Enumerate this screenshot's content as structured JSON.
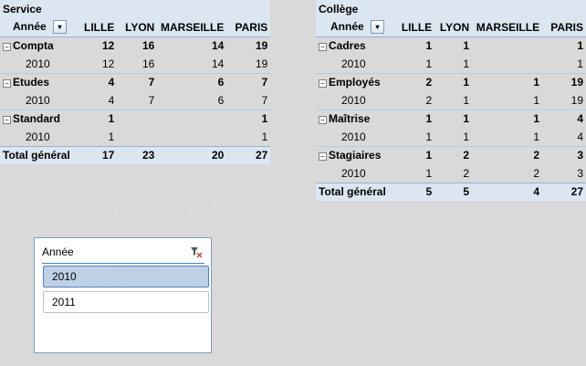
{
  "watermark": "©excel-formations.fr",
  "pivot_left": {
    "title": "Service",
    "row_header": "Année",
    "columns": [
      "LILLE",
      "LYON",
      "MARSEILLE",
      "PARIS"
    ],
    "groups": [
      {
        "label": "Compta",
        "values": [
          "12",
          "16",
          "14",
          "19"
        ],
        "sub_label": "2010",
        "sub_values": [
          "12",
          "16",
          "14",
          "19"
        ]
      },
      {
        "label": "Etudes",
        "values": [
          "4",
          "7",
          "6",
          "7"
        ],
        "sub_label": "2010",
        "sub_values": [
          "4",
          "7",
          "6",
          "7"
        ]
      },
      {
        "label": "Standard",
        "values": [
          "1",
          "",
          "",
          "1"
        ],
        "sub_label": "2010",
        "sub_values": [
          "1",
          "",
          "",
          "1"
        ]
      }
    ],
    "total_label": "Total général",
    "totals": [
      "17",
      "23",
      "20",
      "27"
    ]
  },
  "pivot_right": {
    "title": "Collège",
    "row_header": "Année",
    "columns": [
      "LILLE",
      "LYON",
      "MARSEILLE",
      "PARIS"
    ],
    "groups": [
      {
        "label": "Cadres",
        "values": [
          "1",
          "1",
          "",
          "1"
        ],
        "sub_label": "2010",
        "sub_values": [
          "1",
          "1",
          "",
          "1"
        ]
      },
      {
        "label": "Employés",
        "values": [
          "2",
          "1",
          "1",
          "19"
        ],
        "sub_label": "2010",
        "sub_values": [
          "2",
          "1",
          "1",
          "19"
        ]
      },
      {
        "label": "Maîtrise",
        "values": [
          "1",
          "1",
          "1",
          "4"
        ],
        "sub_label": "2010",
        "sub_values": [
          "1",
          "1",
          "1",
          "4"
        ]
      },
      {
        "label": "Stagiaires",
        "values": [
          "1",
          "2",
          "2",
          "3"
        ],
        "sub_label": "2010",
        "sub_values": [
          "1",
          "2",
          "2",
          "3"
        ]
      }
    ],
    "total_label": "Total général",
    "totals": [
      "5",
      "5",
      "4",
      "27"
    ]
  },
  "slicer": {
    "title": "Année",
    "items": [
      "2010",
      "2011"
    ],
    "selected": "2010"
  },
  "icons": {
    "filter": "filter-dropdown-icon",
    "collapse": "collapse-minus-icon",
    "clear_filter": "clear-filter-icon"
  },
  "colors": {
    "header_fill": "#dce6f1",
    "border_accent": "#95b3d7",
    "slicer_selected": "#b8cce4"
  }
}
